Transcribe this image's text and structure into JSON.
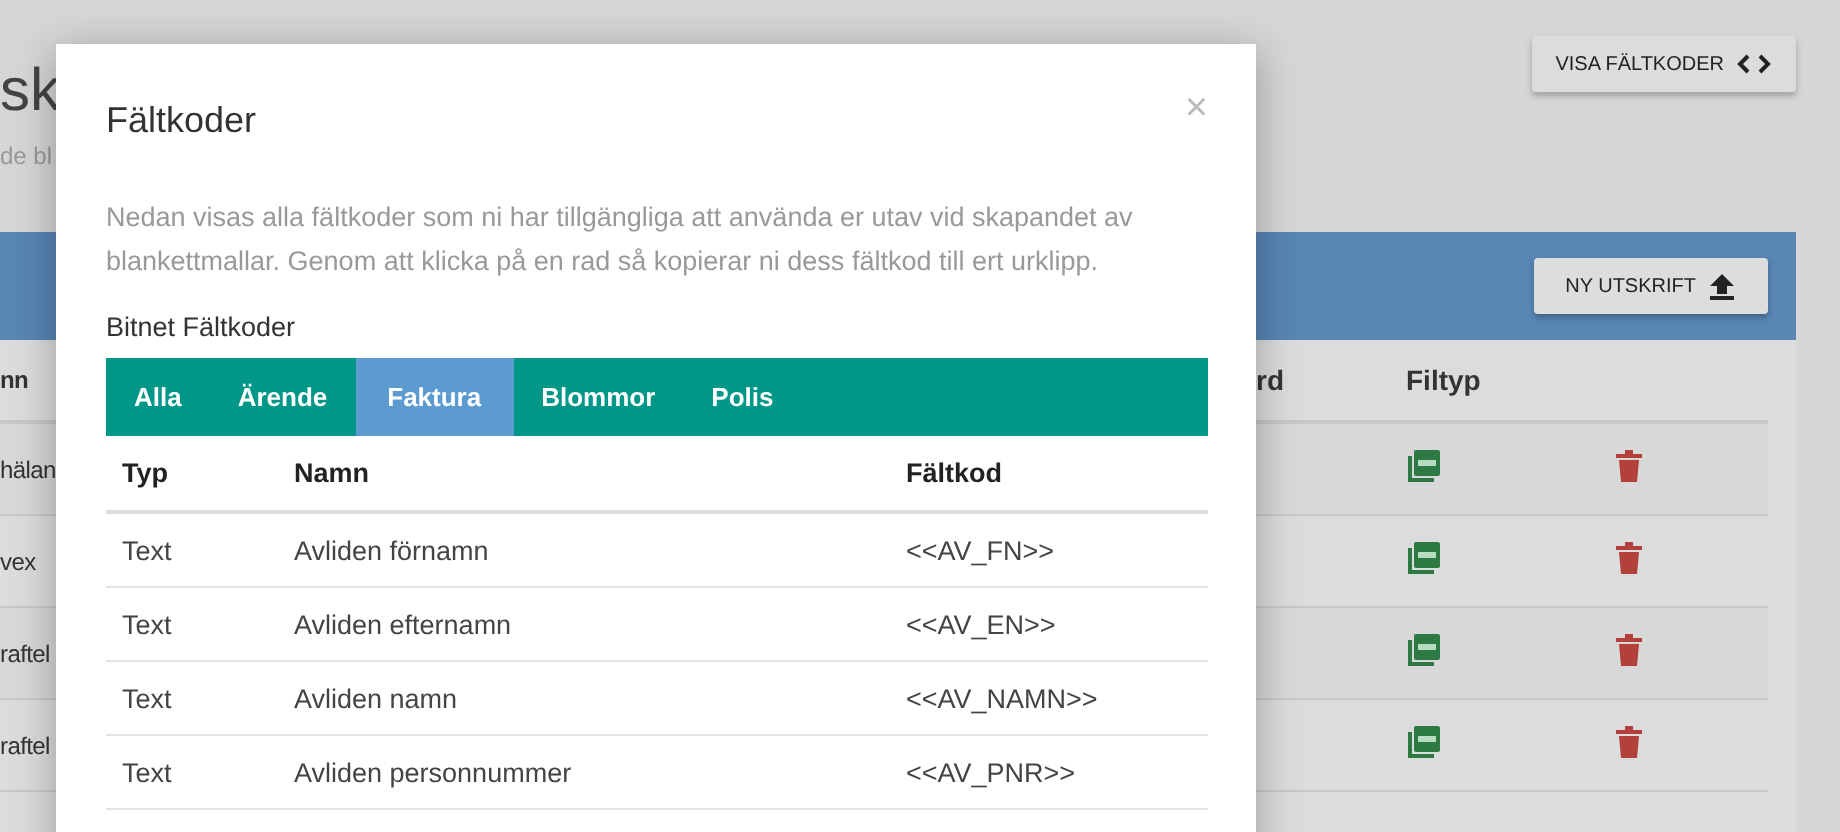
{
  "background": {
    "title": "sk",
    "subtitle": "de bl",
    "show_codes_button": "VISA FÄLTKODER",
    "new_print_button": "NY UTSKRIFT",
    "columns": [
      "nn",
      "rd",
      "Filtyp"
    ],
    "rows": [
      {
        "column_1": "hälan"
      },
      {
        "column_1": "vex"
      },
      {
        "column_1": "raftel"
      },
      {
        "column_1": "raftel"
      }
    ]
  },
  "modal": {
    "title": "Fältkoder",
    "close": "×",
    "description": "Nedan visas alla fältkoder som ni har tillgängliga att använda er utav vid skapandet av blankettmallar. Genom att klicka på en rad så kopierar ni dess fältkod till ert urklipp.",
    "section": "Bitnet Fältkoder",
    "tabs": [
      {
        "label": "Alla",
        "selected": false
      },
      {
        "label": "Ärende",
        "selected": false
      },
      {
        "label": "Faktura",
        "selected": true
      },
      {
        "label": "Blommor",
        "selected": false
      },
      {
        "label": "Polis",
        "selected": false
      }
    ],
    "columns": [
      "Typ",
      "Namn",
      "Fältkod"
    ],
    "rows": [
      {
        "type": "Text",
        "name": "Avliden förnamn",
        "code": "<<AV_FN>>"
      },
      {
        "type": "Text",
        "name": "Avliden efternamn",
        "code": "<<AV_EN>>"
      },
      {
        "type": "Text",
        "name": "Avliden namn",
        "code": "<<AV_NAMN>>"
      },
      {
        "type": "Text",
        "name": "Avliden personnummer",
        "code": "<<AV_PNR>>"
      }
    ]
  }
}
